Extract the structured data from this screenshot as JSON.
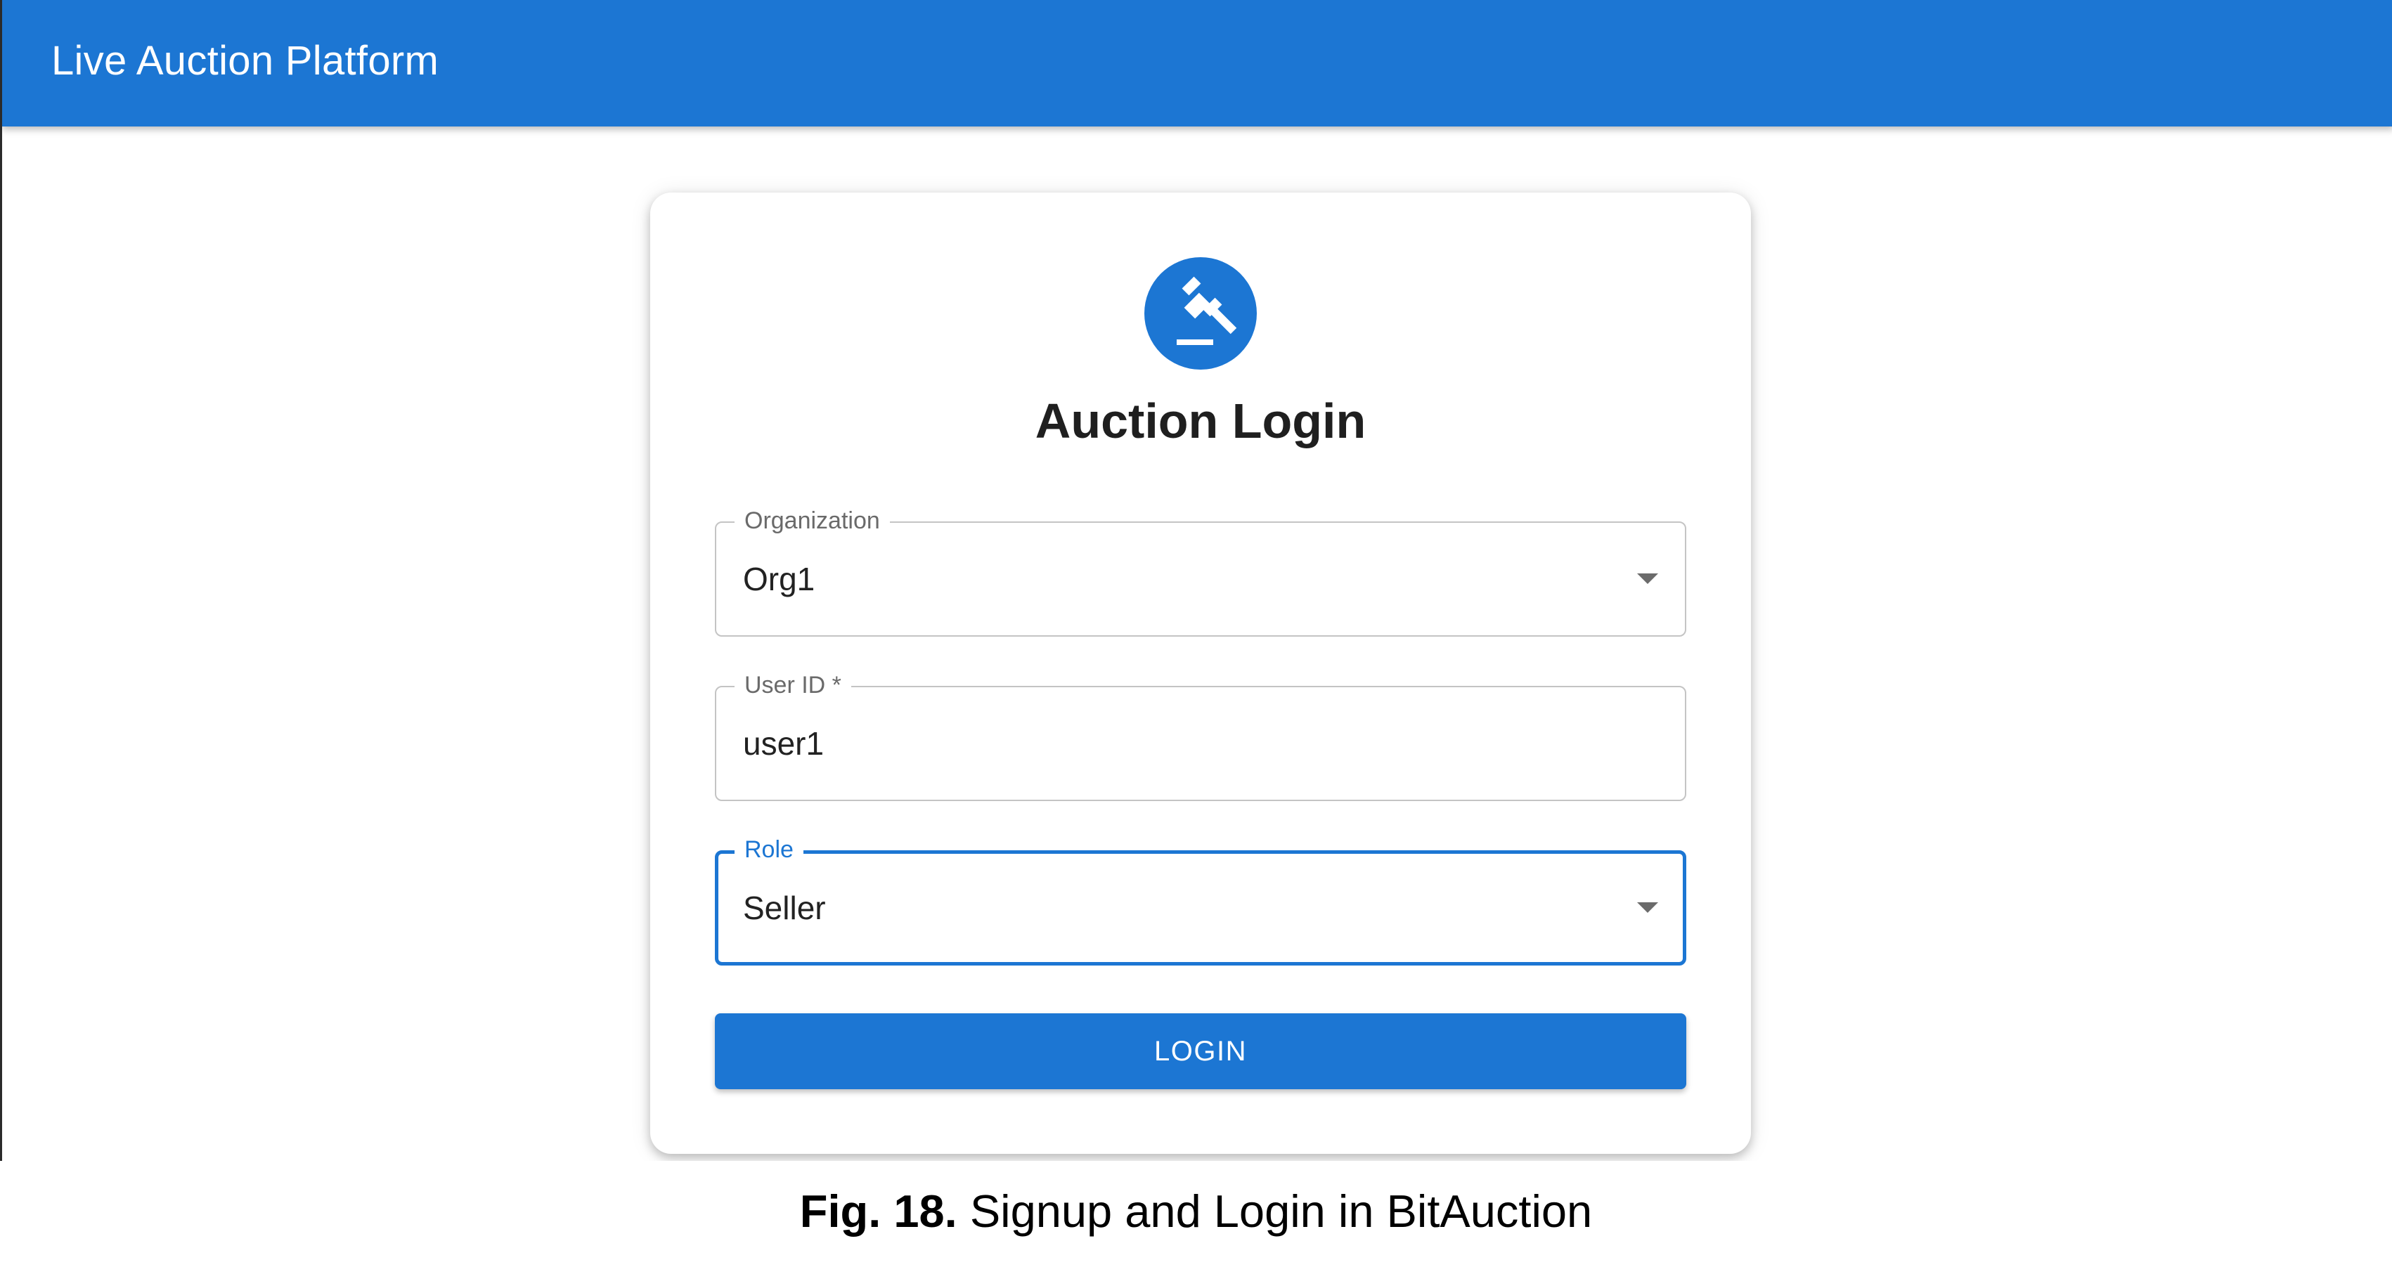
{
  "app": {
    "title": "Live Auction Platform",
    "accent_color": "#1c76d3"
  },
  "login_card": {
    "logo_icon": "gavel-icon",
    "title": "Auction Login",
    "fields": {
      "organization": {
        "label": "Organization",
        "value": "Org1",
        "type": "select"
      },
      "user_id": {
        "label": "User ID *",
        "value": "user1",
        "type": "text"
      },
      "role": {
        "label": "Role",
        "value": "Seller",
        "type": "select",
        "focused": true
      }
    },
    "login_button": "LOGIN"
  },
  "caption": {
    "figure": "Fig. 18.",
    "text": "Signup and Login in BitAuction"
  }
}
